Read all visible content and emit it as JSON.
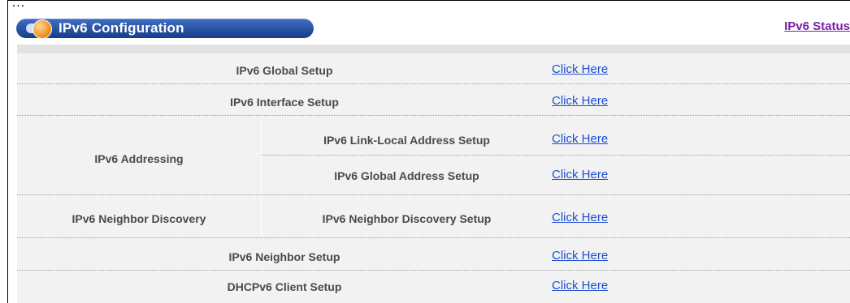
{
  "top_bar": {
    "text": "…"
  },
  "header": {
    "title": "IPv6 Configuration",
    "status_link": "IPv6 Status"
  },
  "rows": [
    {
      "label": "IPv6 Global Setup",
      "link": "Click Here"
    },
    {
      "label": "IPv6 Interface Setup",
      "link": "Click Here"
    },
    {
      "group": "IPv6 Addressing",
      "label": "IPv6 Link-Local Address Setup",
      "link": "Click Here"
    },
    {
      "label": "IPv6 Global Address Setup",
      "link": "Click Here"
    },
    {
      "group": "IPv6 Neighbor Discovery",
      "label": "IPv6 Neighbor Discovery Setup",
      "link": "Click Here"
    },
    {
      "label": "IPv6 Neighbor Setup",
      "link": "Click Here"
    },
    {
      "label": "DHCPv6 Client Setup",
      "link": "Click Here"
    }
  ],
  "colors": {
    "title_pill": "#173c8a",
    "status_link": "#7a1fa8",
    "link": "#1f4fd0",
    "panel": "#f2f2f2"
  }
}
